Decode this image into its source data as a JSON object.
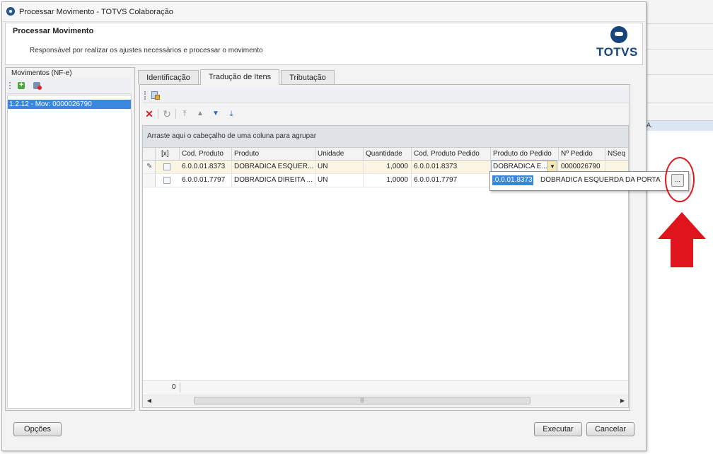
{
  "background_app": {
    "row_label": "A.",
    "letter": "A"
  },
  "window": {
    "title": "Processar Movimento - TOTVS Colaboração"
  },
  "header": {
    "title": "Processar Movimento",
    "subtitle": "Responsável por realizar os ajustes necessários e processar o movimento",
    "logo_text": "TOTVS"
  },
  "left_panel": {
    "title": "Movimentos (NF-e)",
    "items": [
      "1.2.12 - Mov: 0000026790"
    ]
  },
  "tabs": [
    {
      "label": "Identificação"
    },
    {
      "label": "Tradução de Itens",
      "active": true
    },
    {
      "label": "Tributação"
    }
  ],
  "grid": {
    "group_hint": "Arraste aqui o cabeçalho de uma coluna para agrupar",
    "columns": [
      "[x]",
      "Cod. Produto",
      "Produto",
      "Unidade",
      "Quantidade",
      "Cod. Produto Pedido",
      "Produto do Pedido",
      "Nº Pedido",
      "NSeq"
    ],
    "rows": [
      {
        "cod": "6.0.0.01.8373",
        "produto": "DOBRADICA ESQUER...",
        "unidade": "UN",
        "quantidade": "1,0000",
        "cod_pedido": "6.0.0.01.8373",
        "produto_pedido": "DOBRADICA E...",
        "pedido": "0000026790"
      },
      {
        "cod": "6.0.0.01.7797",
        "produto": "DOBRADICA DIREITA ...",
        "unidade": "UN",
        "quantidade": "1,0000",
        "cod_pedido": "6.0.0.01.7797",
        "produto_pedido": "",
        "pedido": ""
      }
    ],
    "footer_count": "0"
  },
  "lookup_popup": {
    "code": ".0.0.01.8373",
    "description": "DOBRADICA ESQUERDA DA PORTA",
    "button_label": "..."
  },
  "buttons": {
    "options": "Opções",
    "execute": "Executar",
    "cancel": "Cancelar"
  },
  "colors": {
    "accent_blue": "#3a87e0",
    "totvs_blue": "#16457e",
    "annotation_red": "#e0141c"
  }
}
